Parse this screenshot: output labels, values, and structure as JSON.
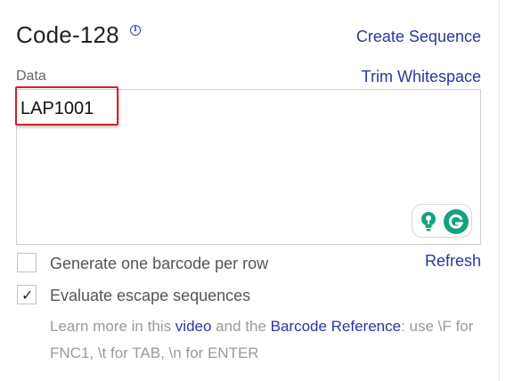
{
  "header": {
    "title": "Code-128",
    "info_icon": "info-icon",
    "create_sequence_label": "Create Sequence"
  },
  "data_section": {
    "label": "Data",
    "trim_whitespace_label": "Trim Whitespace",
    "value": "LAP1001",
    "highlight_color": "#d0232a"
  },
  "grammarly": {
    "bulb_icon": "lightbulb-icon",
    "g_icon": "grammarly-g-icon",
    "accent": "#15a37f"
  },
  "options": {
    "generate_per_row": {
      "label": "Generate one barcode per row",
      "checked": false
    },
    "evaluate_escape": {
      "label": "Evaluate escape sequences",
      "checked": true,
      "checkmark": "✓"
    },
    "refresh_label": "Refresh"
  },
  "help": {
    "prefix": "Learn more in this ",
    "video_link": "video",
    "middle": " and the ",
    "reference_link": "Barcode Reference",
    "suffix": ": use \\F for FNC1, \\t for TAB, \\n for ENTER"
  },
  "colors": {
    "link": "#2b36a1",
    "muted_text": "#9a9a9a"
  }
}
